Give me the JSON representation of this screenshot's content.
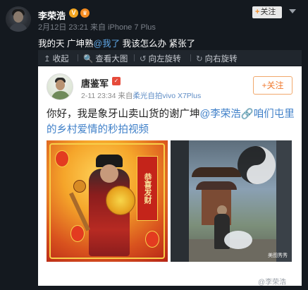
{
  "post": {
    "author": "李荣浩",
    "verified_badge": "V",
    "meta": "2月12日 23:21 来自 iPhone 7 Plus",
    "follow_plus": "+",
    "follow_label": "关注",
    "text_prefix": "我的天 广坤熟",
    "text_mention": "@我了",
    "text_suffix": " 我该怎么办  紧张了"
  },
  "toolbar": {
    "items": [
      {
        "icon": "↥",
        "label": "收起"
      },
      {
        "icon": "🔍",
        "label": "查看大图"
      },
      {
        "icon": "↺",
        "label": "向左旋转"
      },
      {
        "icon": "↻",
        "label": "向右旋转"
      }
    ]
  },
  "card": {
    "author": "唐鉴军",
    "time": "2-11 23:34",
    "source_prefix": " 来自",
    "source": "柔光自拍vivo X7Plus",
    "follow_label": "+关注",
    "text_1": "你好，我是象牙山卖山货的谢广坤",
    "mention": "@李荣浩",
    "topic": "咱们屯里的乡村爱情的秒拍视频",
    "left_scroll_text": "恭喜发财",
    "right_image_watermark": "美图秀秀"
  },
  "footer": {
    "watermark": "@李荣浩"
  },
  "colors": {
    "background": "#14191f",
    "mention": "#5fa7e6",
    "card_link": "#3e7fc8",
    "follow_orange": "#f07a2f"
  }
}
